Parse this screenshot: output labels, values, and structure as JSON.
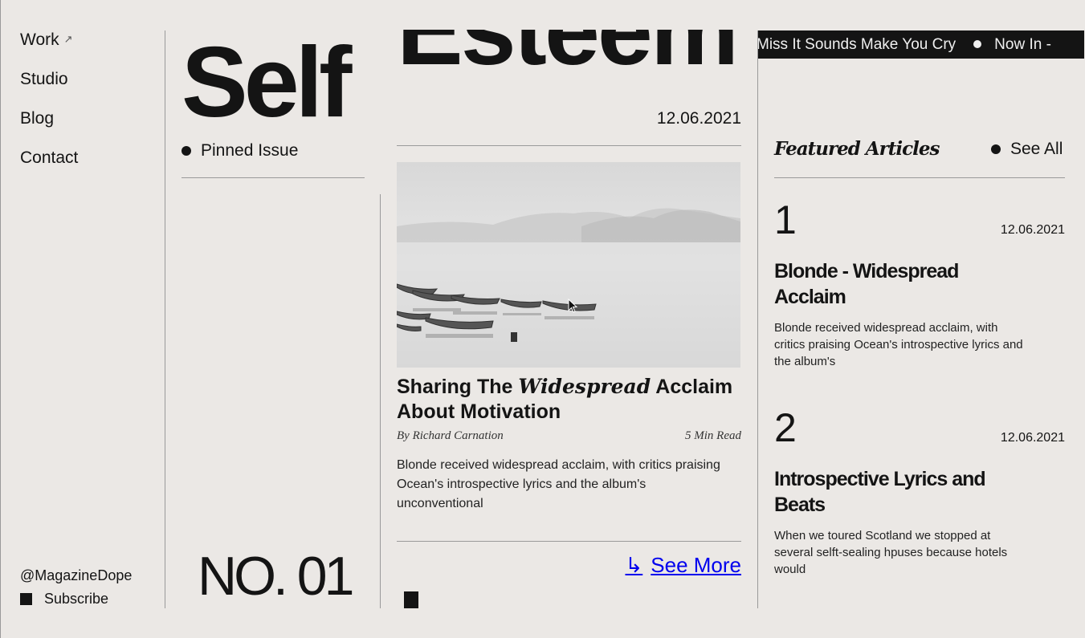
{
  "nav": {
    "items": [
      {
        "label": "Work",
        "external": true
      },
      {
        "label": "Studio"
      },
      {
        "label": "Blog"
      },
      {
        "label": "Contact"
      }
    ],
    "handle": "@MagazineDope",
    "subscribe_label": "Subscribe"
  },
  "headline": {
    "word1": "Self",
    "word2": "Esteem",
    "date": "12.06.2021"
  },
  "pinned": {
    "label": "Pinned Issue",
    "issue_number": "NO. 01"
  },
  "article": {
    "title_pre": "Sharing The ",
    "title_em": "Widespread",
    "title_post": " Acclaim About Motivation",
    "byline": "By Richard Carnation",
    "read_time": "5 Min Read",
    "body": "Blonde received widespread acclaim, with critics praising Ocean's introspective lyrics and the album's unconventional",
    "see_more": "See More"
  },
  "ticker": {
    "items": [
      "Miss It Sounds Make You Cry",
      "Now In -"
    ]
  },
  "featured": {
    "heading": "Featured Articles",
    "see_all": "See All",
    "articles": [
      {
        "number": "1",
        "date": "12.06.2021",
        "title": "Blonde - Widespread Acclaim",
        "body": "Blonde received widespread acclaim, with critics praising Ocean's introspective lyrics and the album's"
      },
      {
        "number": "2",
        "date": "12.06.2021",
        "title": "Introspective Lyrics and Beats",
        "body": "When we toured Scotland we stopped at several selft-sealing hpuses because hotels would"
      }
    ]
  },
  "colors": {
    "background": "#ebe8e5",
    "ink": "#141414",
    "rule": "#9a9a9a"
  }
}
